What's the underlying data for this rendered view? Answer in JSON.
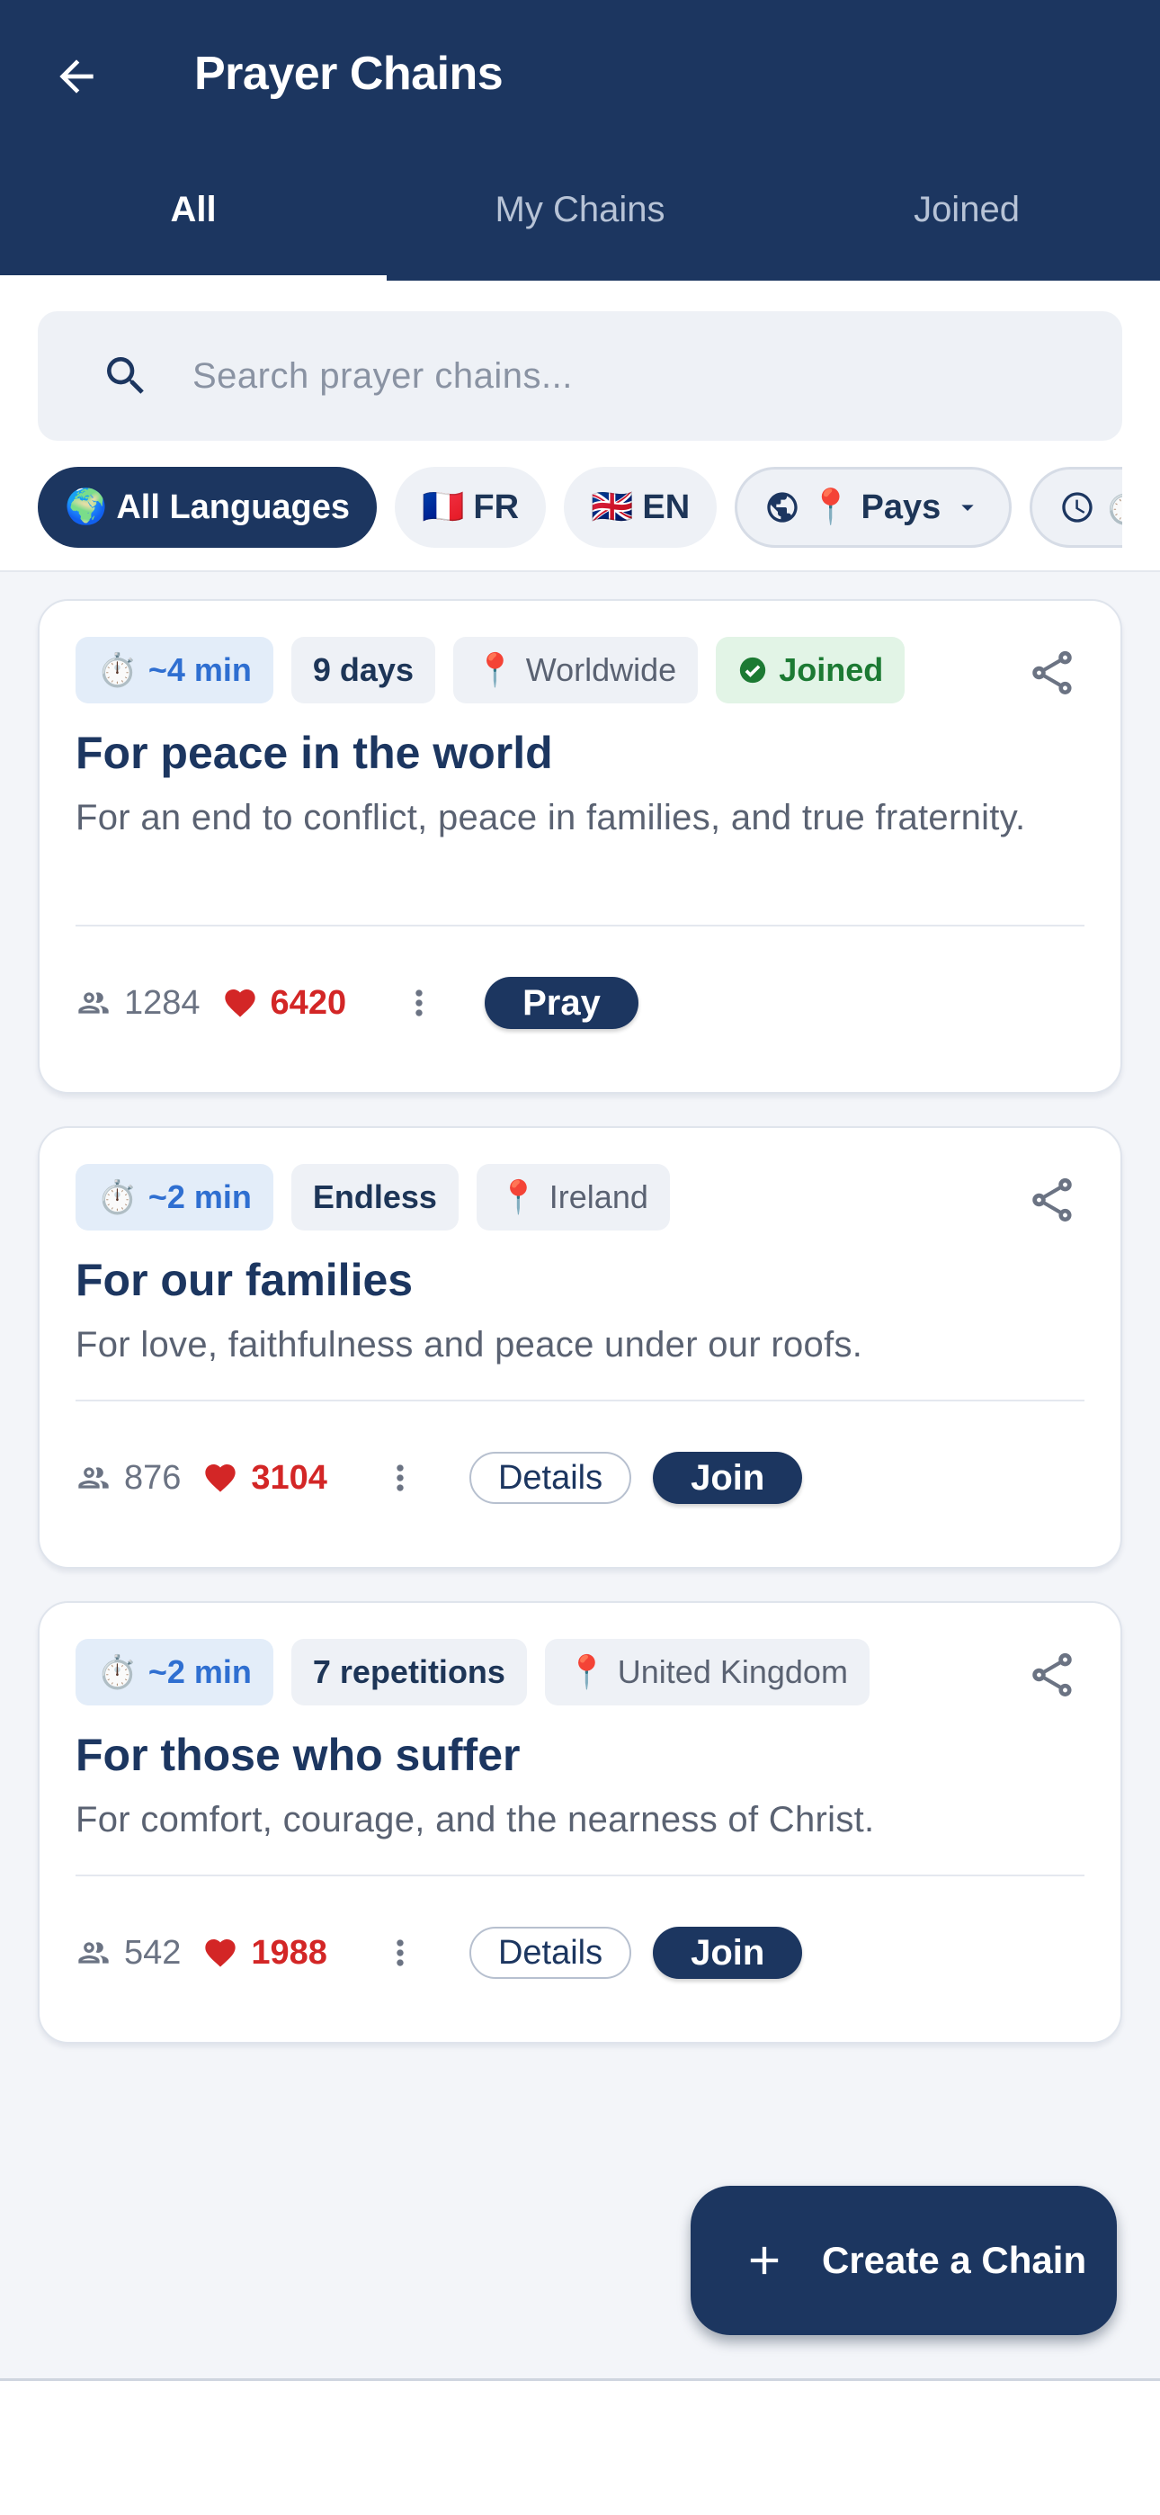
{
  "header": {
    "title": "Prayer Chains",
    "tabs": [
      {
        "label": "All",
        "active": true
      },
      {
        "label": "My Chains",
        "active": false
      },
      {
        "label": "Joined",
        "active": false
      }
    ]
  },
  "search": {
    "placeholder": "Search prayer chains...",
    "value": ""
  },
  "filters": {
    "chips": [
      {
        "emoji": "🌍",
        "label": "All Languages",
        "active": true
      },
      {
        "emoji": "🇫🇷",
        "label": "FR",
        "active": false
      },
      {
        "emoji": "🇬🇧",
        "label": "EN",
        "active": false
      },
      {
        "emoji": "📍",
        "label": "Pays",
        "active": false
      },
      {
        "emoji": "⏱️",
        "label": "",
        "active": false
      }
    ]
  },
  "chains": [
    {
      "time": "~4 min",
      "duration": "9 days",
      "location": "Worldwide",
      "joined_label": "Joined",
      "title": "For peace in the world",
      "description": "For an end to conflict, peace in families, and true fraternity.",
      "members": "1284",
      "likes": "6420",
      "action": "Pray"
    },
    {
      "time": "~2 min",
      "duration": "Endless",
      "location": "Ireland",
      "title": "For our families",
      "description": "For love, faithfulness and peace under our roofs.",
      "members": "876",
      "likes": "3104",
      "details": "Details",
      "action": "Join"
    },
    {
      "time": "~2 min",
      "duration": "7 repetitions",
      "location": "United Kingdom",
      "title": "For those who suffer",
      "description": "For comfort, courage, and the nearness of Christ.",
      "members": "542",
      "likes": "1988",
      "details": "Details",
      "action": "Join"
    }
  ],
  "fab": {
    "label": "Create a Chain",
    "icon": "plus-icon"
  },
  "colors": {
    "primary": "#1c3660",
    "accent_blue": "#2f6fd1",
    "like_red": "#d32626",
    "joined_green": "#1c7a33"
  }
}
